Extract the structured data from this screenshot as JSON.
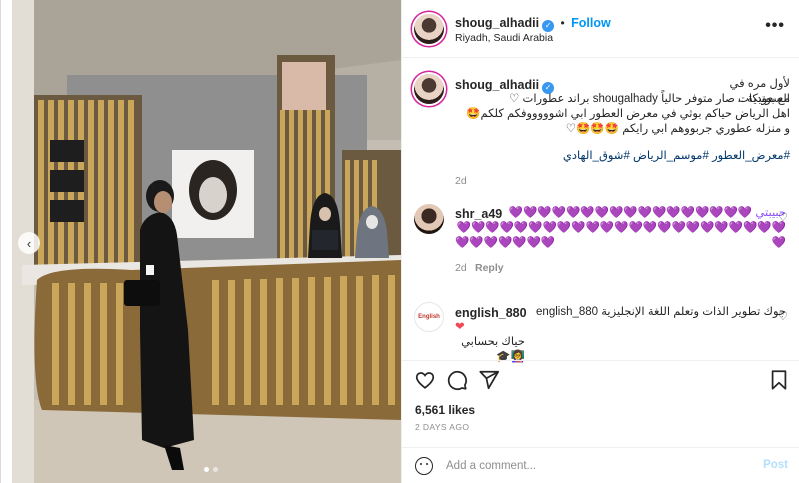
{
  "post": {
    "username": "shoug_alhadii",
    "follow_label": "Follow",
    "location": "Riyadh, Saudi Arabia",
    "more_label": "•••"
  },
  "caption": {
    "username": "shoug_alhadii",
    "line1": "لأول مره في السعودية ..",
    "line2": "مع بوتيكات صار متوفر حالياً shougalhady براند عطورات ♡",
    "line3": "اهل الرياض حياكم بوثي في معرض العطور ابي اشوووووفكم كلكم🤩",
    "line4": "و منزله عطوري جربووهم ابي رايكم 🤩🤩🤩♡",
    "hashtags": "#معرض_العطور #موسم_الرياض #شوق_الهادي",
    "age": "2d"
  },
  "comments": [
    {
      "username": "shr_a49",
      "text_line1": "حبيبتي 💜💜💜💜💜💜💜💜💜💜💜💜💜💜💜💜💜💜💜💜💜",
      "text_line2": "💜💜💜💜💜💜💜💜💜💜💜💜💜💜💜💜💜💜💜💜💜💜💜💜",
      "text_line3": "💜💜💜💜💜💜💜",
      "age": "2d",
      "reply_label": "Reply"
    },
    {
      "username": "english_880",
      "text_line1": "جوك تطوير الذات وتعلم اللغة الإنجليزية english_880",
      "text_line2": "❤",
      "text_line3": "حياك بحسابي 👩‍🏫🎓"
    }
  ],
  "stats": {
    "likes": "6,561 likes",
    "time": "2 DAYS AGO"
  },
  "add_comment": {
    "placeholder": "Add a comment...",
    "post_label": "Post"
  },
  "icons": {
    "verified": "verified-badge-icon",
    "like": "heart-icon",
    "comment": "comment-icon",
    "share": "share-plane-icon",
    "save": "bookmark-icon",
    "emoji": "emoji-icon",
    "prev": "chevron-left-icon"
  },
  "colors": {
    "accent": "#0095f6",
    "verified": "#3897f0",
    "hashtag": "#00376b",
    "heart_purple": "#8a4fff"
  }
}
